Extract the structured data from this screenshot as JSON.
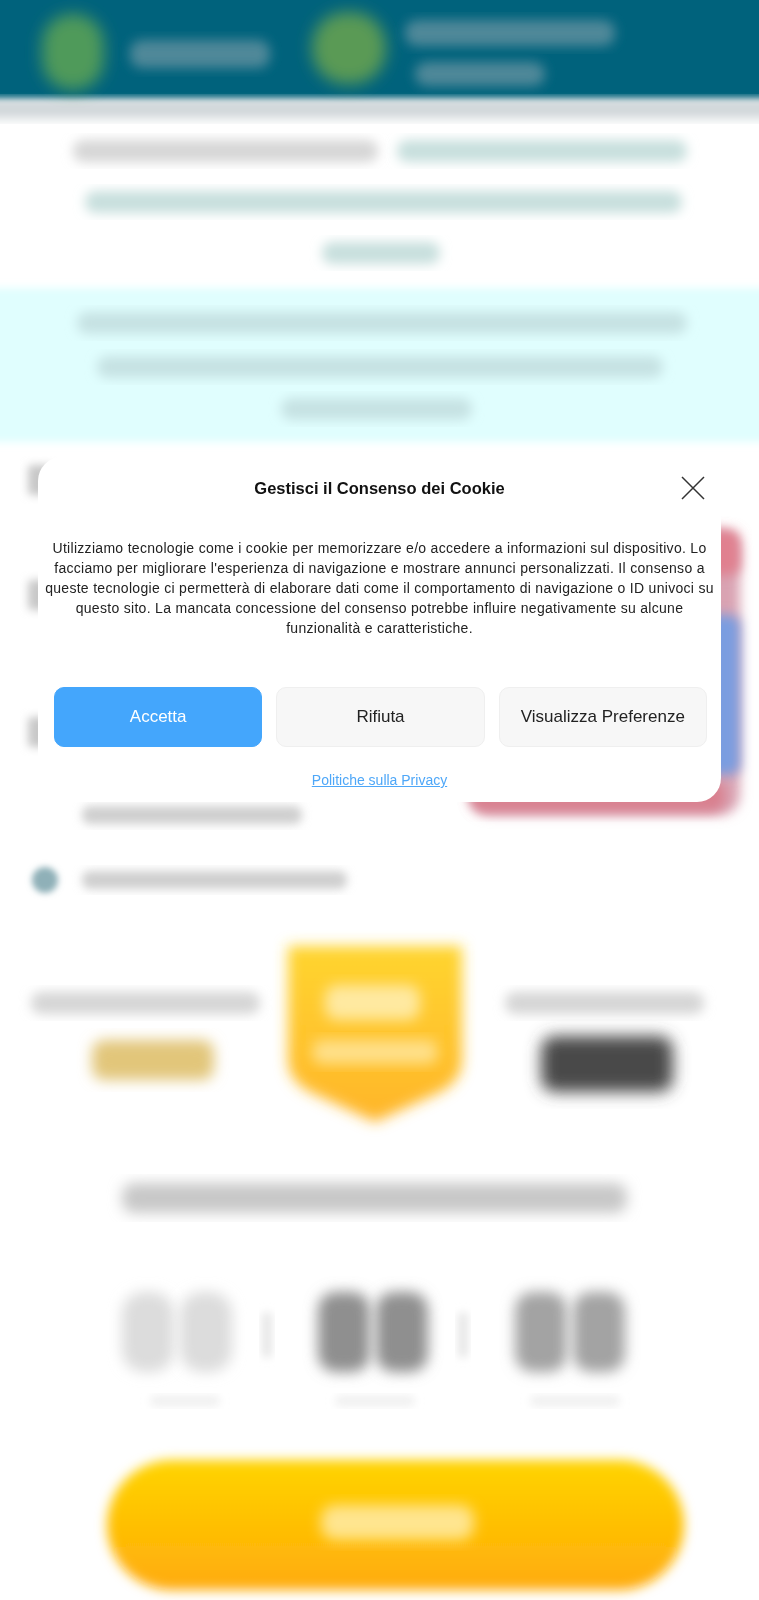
{
  "dialog": {
    "title": "Gestisci il Consenso dei Cookie",
    "message": "Utilizziamo tecnologie come i cookie per memorizzare e/o accedere a informazioni sul dispositivo. Lo facciamo per migliorare l'esperienza di navigazione e mostrare annunci personalizzati. Il consenso a queste tecnologie ci permetterà di elaborare dati come il comportamento di navigazione o ID univoci su questo sito. La mancata concessione del consenso potrebbe influire negativamente su alcune funzionalità e caratteristiche.",
    "buttons": [
      {
        "label": "Accetta",
        "kind": "primary"
      },
      {
        "label": "Rifiuta",
        "kind": "secondary"
      },
      {
        "label": "Visualizza Preferenze",
        "kind": "secondary"
      }
    ],
    "link": "Politiche sulla Privacy"
  }
}
